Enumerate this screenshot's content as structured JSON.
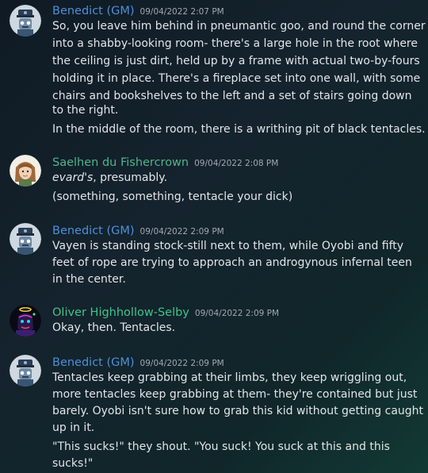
{
  "colors": {
    "gm_name": "#4f8fd9",
    "saelhen_name": "#4fb58a",
    "oliver_name": "#3fc48a",
    "timestamp": "#a3a7b1",
    "text": "#e2e4e8"
  },
  "messages": [
    {
      "author": "Benedict (GM)",
      "timestamp": "09/04/2022 2:07 PM",
      "avatar_icon": "robot-avatar",
      "lines": [
        "So, you leave him behind in pneumantic goo, and round the corner",
        "into a shabby-looking room- there's a large hole in the root where",
        "the ceiling is just dirt, held up by a frame with actual two-by-fours",
        "holding it in place. There's a fireplace set into one wall, with some",
        "chairs and bookshelves to the left and a set of stairs going down",
        "to the right."
      ],
      "line2": "In the middle of the room, there is a writhing pit of black tentacles."
    },
    {
      "author": "Saelhen du Fishercrown",
      "timestamp": "09/04/2022 2:08 PM",
      "avatar_icon": "elf-portrait-avatar",
      "line1_italic": "evard's",
      "line1_rest": ", presumably.",
      "line2": "(something, something, tentacle your dick)"
    },
    {
      "author": "Benedict (GM)",
      "timestamp": "09/04/2022 2:09 PM",
      "avatar_icon": "robot-avatar",
      "lines": [
        "Vayen is standing stock-still next to them, while Oyobi and fifty",
        "feet of rope are trying to approach an androgynous infernal teen",
        "in the center."
      ]
    },
    {
      "author": "Oliver Highhollow-Selby",
      "timestamp": "09/04/2022 2:09 PM",
      "avatar_icon": "neon-face-avatar",
      "lines": [
        "Okay, then. Tentacles."
      ]
    },
    {
      "author": "Benedict (GM)",
      "timestamp": "09/04/2022 2:09 PM",
      "avatar_icon": "robot-avatar",
      "lines": [
        "Tentacles keep grabbing at their limbs, they keep wriggling out,",
        "more tentacles keep grabbing at them- they're contained but just",
        "barely. Oyobi isn't sure how to grab this kid without getting caught",
        "up in it."
      ],
      "lines2": [
        "\"This sucks!\" they shout. \"You suck! You suck at this and this",
        "sucks!\""
      ]
    }
  ]
}
